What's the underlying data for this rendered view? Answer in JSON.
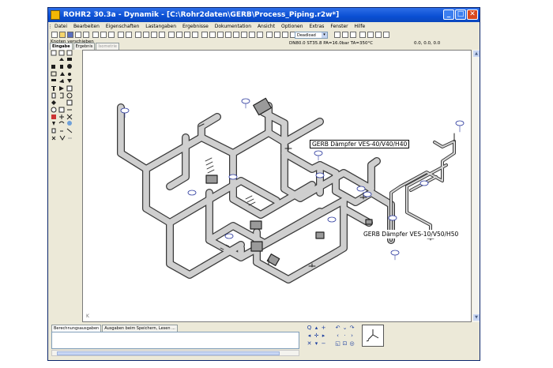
{
  "window": {
    "title": "ROHR2 30.3a - Dynamik - [C:\\Rohr2daten\\GERB\\Process_Piping.r2w*]",
    "controls": {
      "minimize": "_",
      "maximize": "□",
      "close": "✕"
    }
  },
  "menu": [
    "Datei",
    "Bearbeiten",
    "Eigenschaften",
    "Lastangaben",
    "Ergebnisse",
    "Dokumentation",
    "Ansicht",
    "Optionen",
    "Extras",
    "Fenster",
    "Hilfe"
  ],
  "toolbar": {
    "status": "DN80.0   ST35.8   PA=16.0bar  TA=350°C",
    "coords": "0.0, 0.0, 0.0",
    "combo_value": "Deadload"
  },
  "sidebar": {
    "mode_label": "Knoten verschieben",
    "tabs": [
      "Eingabe",
      "Ergebnis",
      "Isometrie"
    ]
  },
  "canvas": {
    "annotations": [
      "GERB Dämpfer VES-40/V40/H40",
      "GERB Dämpfer VES-10/V50/H50"
    ]
  },
  "bottom": {
    "tabs": [
      "Berechnungsausgaben",
      "Ausgaben beim Speichern, Lesen ..."
    ]
  },
  "colors": {
    "pipe_fill": "#c9c9c9",
    "pipe_stroke": "#3a3a3a",
    "node_tag": "#2c3a9e",
    "titlebar": "#0a4fd3"
  }
}
